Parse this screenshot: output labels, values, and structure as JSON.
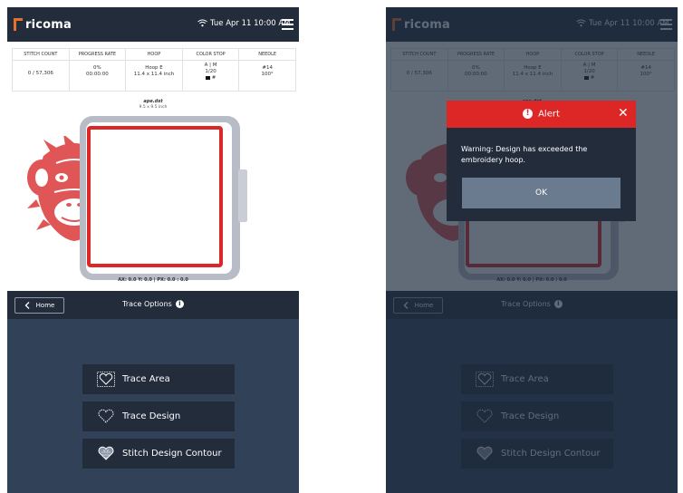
{
  "header": {
    "logo_text": "ricoma",
    "datetime": "Tue Apr 11  10:00 AM"
  },
  "stats": {
    "stitch_count": {
      "label": "STITCH COUNT",
      "value": "0 / 57,306"
    },
    "progress_rate": {
      "label": "PROGRESS RATE",
      "percent": "0%",
      "time": "00:00:00"
    },
    "hoop": {
      "label": "HOOP",
      "name": "Hoop E",
      "size": "11.4 x 11.4 inch"
    },
    "color_stop": {
      "label": "COLOR STOP",
      "mode": "A | M",
      "count": "1/20",
      "swatch_text": "#"
    },
    "needle": {
      "label": "NEEDLE",
      "number": "#14",
      "angle": "100°"
    }
  },
  "design": {
    "file_name": "ape.dst",
    "file_size": "9.5 x 9.5 inch",
    "coords": "AX: 0.0 Y: 0.0 | PX: 0.0 : 0.0"
  },
  "panel": {
    "home_label": "Home",
    "title": "Trace Options",
    "buttons": [
      {
        "label": "Trace Area",
        "icon": "trace-area-icon"
      },
      {
        "label": "Trace Design",
        "icon": "trace-design-icon"
      },
      {
        "label": "Stitch Design Contour",
        "icon": "stitch-contour-icon"
      }
    ]
  },
  "alert": {
    "title": "Alert",
    "message": "Warning: Design has exceeded the embroidery hoop.",
    "ok_label": "OK"
  },
  "colors": {
    "navy": "#222c3b",
    "panel": "#314157",
    "accent_red": "#dd2626",
    "logo_orange": "#e8702a",
    "hoop_gray": "#b7bcc6"
  }
}
